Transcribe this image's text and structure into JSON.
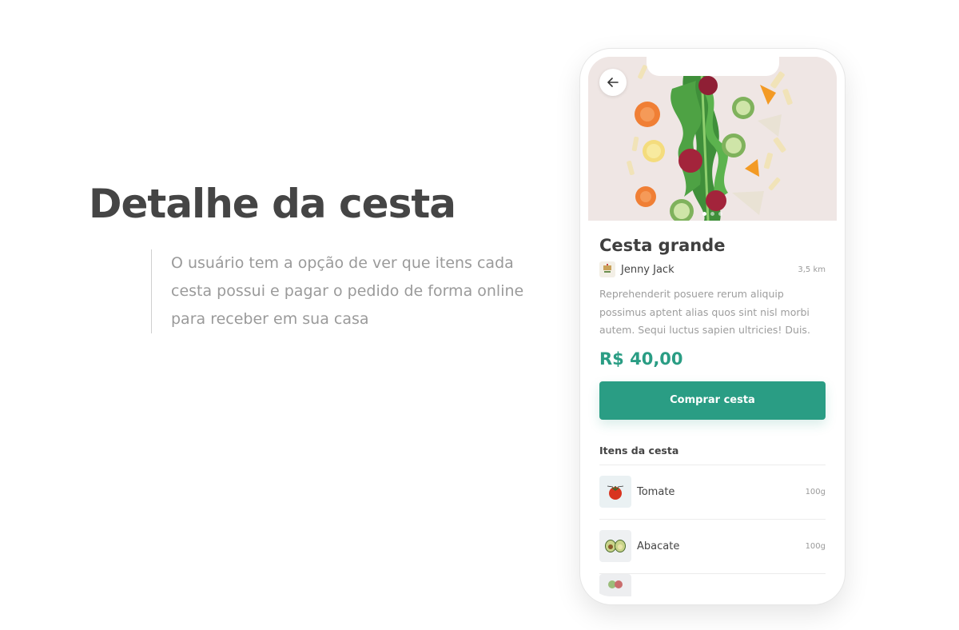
{
  "intro": {
    "title": "Detalhe da cesta",
    "description": "O usuário tem a opção de ver que itens cada cesta possui e pagar o pedido de forma online para receber em sua casa"
  },
  "app": {
    "back_icon": "arrow-left-icon",
    "carousel": {
      "count": 3,
      "active": 1
    },
    "product": {
      "title": "Cesta grande",
      "seller": "Jenny Jack",
      "distance": "3,5 km",
      "description": "Reprehenderit posuere rerum aliquip possimus aptent alias quos sint nisl morbi autem. Sequi luctus sapien ultricies! Duis.",
      "price": "R$ 40,00"
    },
    "buy_button": "Comprar cesta",
    "items_title": "Itens da cesta",
    "items": [
      {
        "name": "Tomate",
        "qty": "100g",
        "icon": "tomato-icon"
      },
      {
        "name": "Abacate",
        "qty": "100g",
        "icon": "avocado-icon"
      }
    ]
  },
  "colors": {
    "accent": "#2a9d84",
    "title": "#454545",
    "muted": "#9a9a9a"
  }
}
